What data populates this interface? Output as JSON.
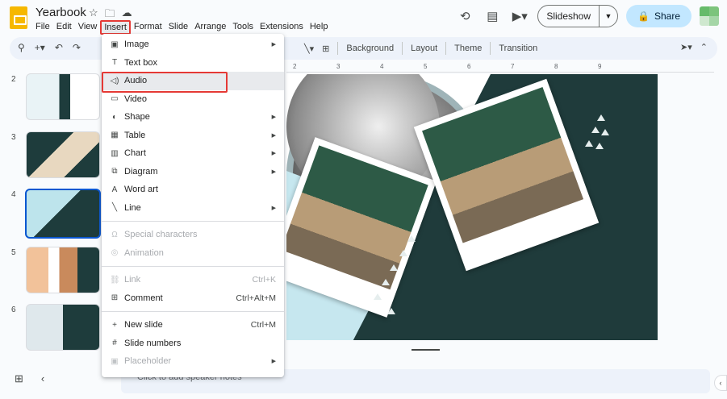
{
  "window": {
    "doc_title": "Yearbook"
  },
  "menubar": [
    "File",
    "Edit",
    "View",
    "Insert",
    "Format",
    "Slide",
    "Arrange",
    "Tools",
    "Extensions",
    "Help"
  ],
  "header": {
    "slideshow_label": "Slideshow",
    "share_label": "Share"
  },
  "toolbar": {
    "background_label": "Background",
    "layout_label": "Layout",
    "theme_label": "Theme",
    "transition_label": "Transition"
  },
  "filmstrip": {
    "slides": [
      "2",
      "3",
      "4",
      "5",
      "6"
    ],
    "selected": "4"
  },
  "ruler": {
    "ticks": [
      "2",
      "3",
      "4",
      "5",
      "6",
      "7",
      "8",
      "9"
    ]
  },
  "insert_menu": {
    "items": [
      {
        "label": "Image",
        "icon": "image-icon",
        "submenu": true,
        "disabled": false
      },
      {
        "label": "Text box",
        "icon": "text-box-icon",
        "submenu": false,
        "disabled": false
      },
      {
        "label": "Audio",
        "icon": "audio-icon",
        "submenu": false,
        "disabled": false,
        "highlighted": true
      },
      {
        "label": "Video",
        "icon": "video-icon",
        "submenu": false,
        "disabled": false
      },
      {
        "label": "Shape",
        "icon": "shape-icon",
        "submenu": true,
        "disabled": false
      },
      {
        "label": "Table",
        "icon": "table-icon",
        "submenu": true,
        "disabled": false
      },
      {
        "label": "Chart",
        "icon": "chart-icon",
        "submenu": true,
        "disabled": false
      },
      {
        "label": "Diagram",
        "icon": "diagram-icon",
        "submenu": true,
        "disabled": false
      },
      {
        "label": "Word art",
        "icon": "word-art-icon",
        "submenu": false,
        "disabled": false
      },
      {
        "label": "Line",
        "icon": "line-icon",
        "submenu": true,
        "disabled": false
      },
      {
        "label": "Special characters",
        "icon": "omega-icon",
        "submenu": false,
        "disabled": true
      },
      {
        "label": "Animation",
        "icon": "animation-icon",
        "submenu": false,
        "disabled": true
      },
      {
        "label": "Link",
        "icon": "link-icon",
        "shortcut": "Ctrl+K",
        "disabled": true
      },
      {
        "label": "Comment",
        "icon": "comment-icon",
        "shortcut": "Ctrl+Alt+M",
        "disabled": false
      },
      {
        "label": "New slide",
        "icon": "plus-icon",
        "shortcut": "Ctrl+M",
        "disabled": false
      },
      {
        "label": "Slide numbers",
        "icon": "hash-icon",
        "submenu": false,
        "disabled": false
      },
      {
        "label": "Placeholder",
        "icon": "placeholder-icon",
        "submenu": true,
        "disabled": true
      }
    ]
  },
  "speaker_notes": {
    "placeholder": "Click to add speaker notes"
  },
  "colors": {
    "accent_blue": "#0b57d0",
    "highlight_red": "#e53935",
    "share_bg": "#c2e7ff",
    "slide_dark": "#1f3b3b",
    "slide_light": "#c6e7ef"
  }
}
